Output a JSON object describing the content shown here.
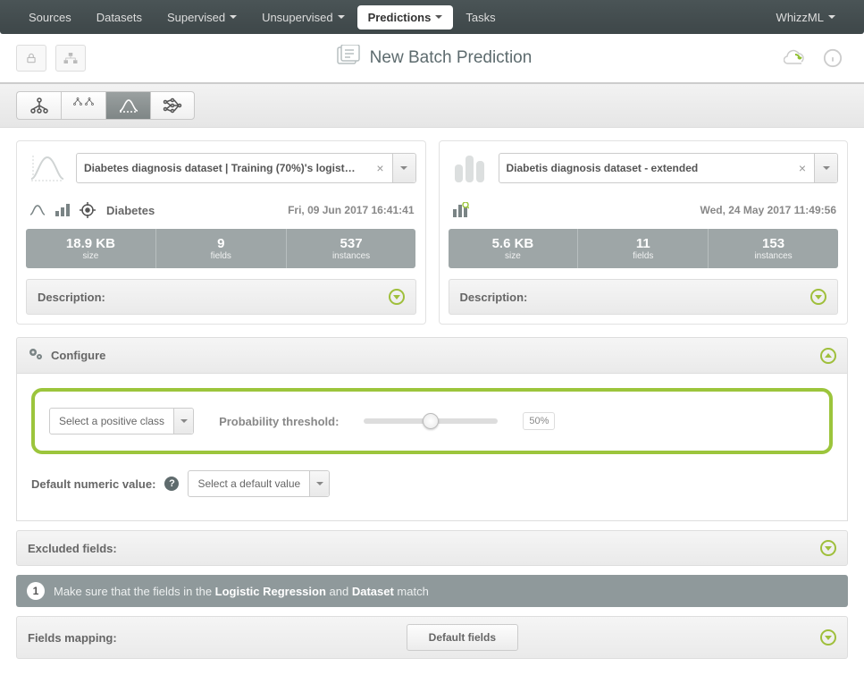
{
  "nav": {
    "items": [
      "Sources",
      "Datasets",
      "Supervised",
      "Unsupervised",
      "Predictions",
      "Tasks"
    ],
    "active_index": 4,
    "right": "WhizzML"
  },
  "page": {
    "title": "New Batch Prediction"
  },
  "left_panel": {
    "select": "Diabetes diagnosis dataset | Training (70%)'s logist…",
    "target": "Diabetes",
    "date": "Fri, 09 Jun 2017 16:41:41",
    "stats": {
      "size": "18.9 KB",
      "size_l": "size",
      "fields": "9",
      "fields_l": "fields",
      "instances": "537",
      "instances_l": "instances"
    },
    "description": "Description:"
  },
  "right_panel": {
    "select": "Diabetis diagnosis dataset - extended",
    "date": "Wed, 24 May 2017 11:49:56",
    "stats": {
      "size": "5.6 KB",
      "size_l": "size",
      "fields": "11",
      "fields_l": "fields",
      "instances": "153",
      "instances_l": "instances"
    },
    "description": "Description:"
  },
  "configure": {
    "title": "Configure",
    "positive_class_placeholder": "Select a positive class",
    "threshold_label": "Probability threshold:",
    "threshold_value": "50%",
    "default_numeric_label": "Default numeric value:",
    "default_numeric_placeholder": "Select a default value"
  },
  "excluded": {
    "label": "Excluded fields:"
  },
  "hint": {
    "num": "1",
    "pre": "Make sure that the fields in the ",
    "b1": "Logistic Regression",
    "mid": " and ",
    "b2": "Dataset",
    "post": " match"
  },
  "mapping": {
    "label": "Fields mapping:",
    "button": "Default fields"
  }
}
